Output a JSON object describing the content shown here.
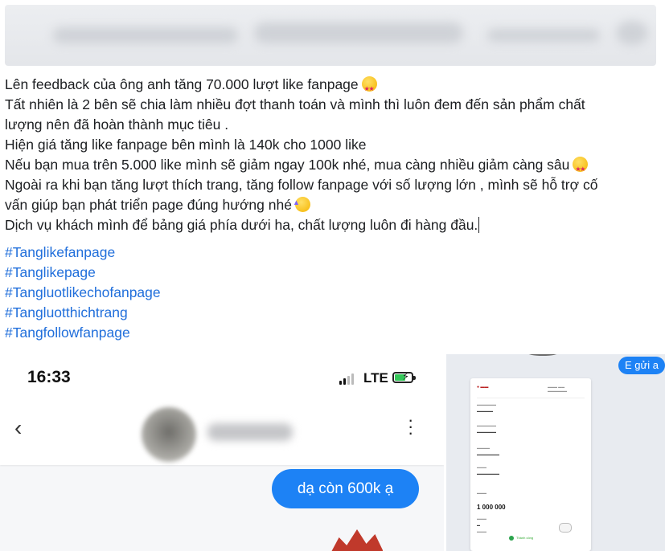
{
  "post": {
    "lines": [
      "Lên feedback của ông anh tăng  70.000 lượt like fanpage",
      "Tất nhiên là 2 bên sẽ chia làm nhiều đợt thanh toán và mình thì luôn đem đến sản phẩm chất",
      "lượng nên đã hoàn thành mục tiêu .",
      "Hiện giá tăng like fanpage bên mình là 140k cho 1000 like",
      "Nếu bạn mua trên 5.000 like mình sẽ giảm ngay 100k nhé, mua càng nhiều giảm càng sâu",
      "Ngoài ra khi bạn tăng lượt thích trang, tăng follow fanpage với số lượng lớn , mình sẽ hỗ trợ cố",
      "vấn giúp bạn phát triển page đúng hướng nhé",
      "Dịch vụ khách mình để bảng giá phía dưới ha, chất lượng luôn đi hàng đầu."
    ],
    "emoji_1": "star-struck-emoji",
    "emoji_2": "star-struck-emoji",
    "emoji_3": "partying-face-emoji",
    "hashtags": [
      "#Tanglikefanpage",
      "#Tanglikepage",
      "#Tangluotlikechofanpage",
      "#Tangluotthichtrang",
      "#Tangfollowfanpage"
    ]
  },
  "chat_screenshot": {
    "time": "16:33",
    "network": "LTE",
    "back_icon": "chevron-left-icon",
    "more_icon": "more-vertical-icon",
    "message": "dạ còn 600k ạ",
    "bubble_color": "#1d82f5"
  },
  "receipt_screenshot": {
    "sent_label": "E gửi a",
    "amount": "1 000 000",
    "status": "Thành công"
  },
  "colors": {
    "hashtag": "#216fdb",
    "text": "#1c1e21"
  }
}
